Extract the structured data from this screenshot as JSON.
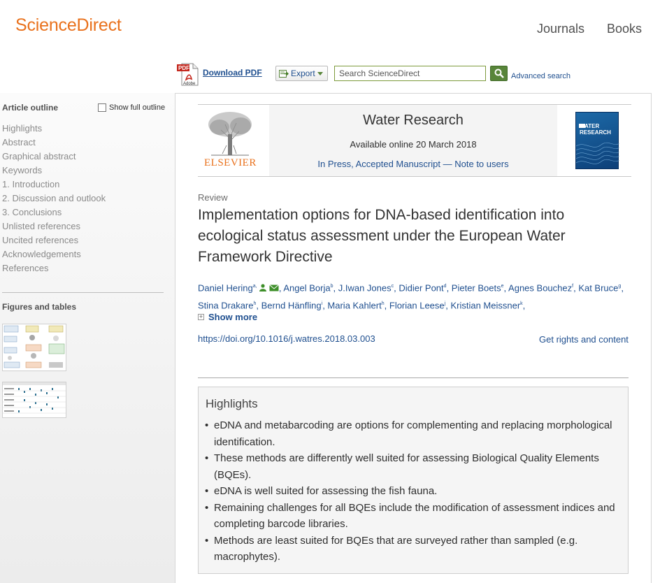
{
  "header": {
    "logo": "ScienceDirect",
    "nav": [
      "Journals",
      "Books"
    ]
  },
  "toolbar": {
    "pdf_icon_label": "PDF",
    "pdf_icon_brand": "Adobe",
    "download_pdf": "Download PDF",
    "export": "Export",
    "search_placeholder": "Search ScienceDirect",
    "advanced_search": "Advanced search"
  },
  "sidebar": {
    "outline_title": "Article outline",
    "show_full_outline": "Show full outline",
    "items": [
      "Highlights",
      "Abstract",
      "Graphical abstract",
      "Keywords",
      "1. Introduction",
      "2. Discussion and outlook",
      "3. Conclusions",
      "Unlisted references",
      "Uncited references",
      "Acknowledgements",
      "References"
    ],
    "figures_title": "Figures and tables"
  },
  "publication": {
    "journal": "Water Research",
    "available": "Available online 20 March 2018",
    "in_press": "In Press, Accepted Manuscript",
    "separator": "—",
    "note": "Note to users",
    "publisher_logo_text": "ELSEVIER",
    "cover_title": "WATER RESEARCH"
  },
  "article": {
    "type": "Review",
    "title": "Implementation options for DNA-based identification into ecological status assessment under the European Water Framework Directive",
    "authors": [
      {
        "name": "Daniel Hering",
        "sup": "a,"
      },
      {
        "name": "Angel Borja",
        "sup": "b"
      },
      {
        "name": "J.Iwan Jones",
        "sup": "c"
      },
      {
        "name": "Didier Pont",
        "sup": "d"
      },
      {
        "name": "Pieter Boets",
        "sup": "e"
      },
      {
        "name": "Agnes Bouchez",
        "sup": "f"
      },
      {
        "name": "Kat Bruce",
        "sup": "g"
      },
      {
        "name": "Stina Drakare",
        "sup": "h"
      },
      {
        "name": "Bernd Hänfling",
        "sup": "i"
      },
      {
        "name": "Maria Kahlert",
        "sup": "h"
      },
      {
        "name": "Florian Leese",
        "sup": "j"
      },
      {
        "name": "Kristian Meissner",
        "sup": "k"
      }
    ],
    "show_more": "Show more",
    "doi": "https://doi.org/10.1016/j.watres.2018.03.003",
    "rights": "Get rights and content"
  },
  "highlights": {
    "title": "Highlights",
    "items": [
      "eDNA and metabarcoding are options for complementing and replacing morphological identification.",
      "These methods are differently well suited for assessing Biological Quality Elements (BQEs).",
      "eDNA is well suited for assessing the fish fauna.",
      "Remaining challenges for all BQEs include the modification of assessment indices and completing barcode libraries.",
      "Methods are least suited for BQEs that are surveyed rather than sampled (e.g. macrophytes)."
    ]
  },
  "colors": {
    "brand_orange": "#e9711c",
    "link_blue": "#1f4f8f",
    "search_green": "#58853a"
  },
  "icons": [
    "pdf-icon",
    "export-icon",
    "search-icon",
    "person-icon",
    "envelope-icon",
    "plus-icon",
    "tree-logo",
    "journal-cover"
  ]
}
